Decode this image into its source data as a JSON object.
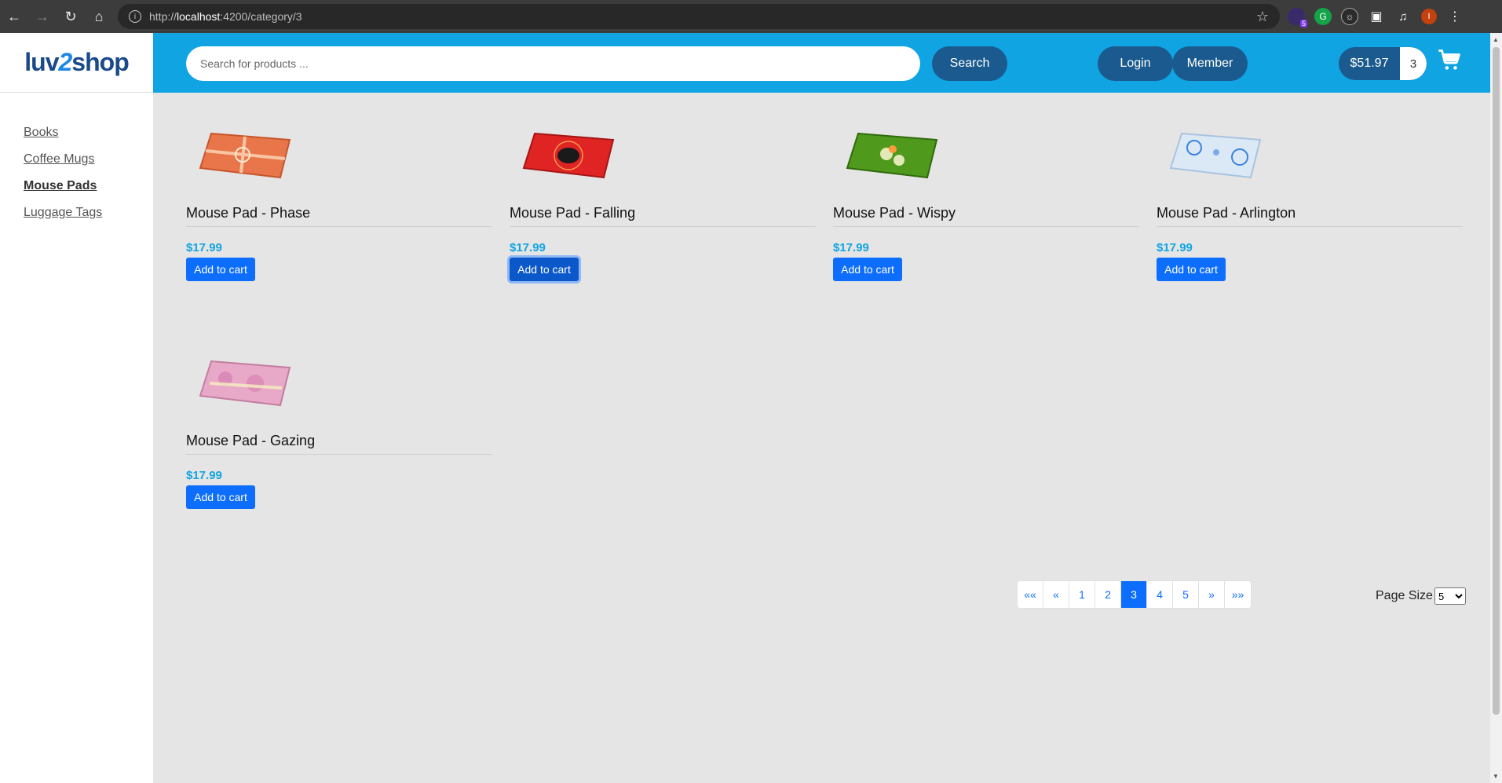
{
  "browser": {
    "url_prefix": "http://",
    "url_host": "localhost",
    "url_path": ":4200/category/3",
    "ext_badge": "5",
    "profile_initial": "I"
  },
  "logo": {
    "part1": "luv",
    "part2": "2",
    "part3": "shop"
  },
  "sidebar": {
    "items": [
      {
        "label": "Books"
      },
      {
        "label": "Coffee Mugs"
      },
      {
        "label": "Mouse Pads",
        "active": true
      },
      {
        "label": "Luggage Tags"
      }
    ]
  },
  "header": {
    "search_placeholder": "Search for products ...",
    "search_label": "Search",
    "login_label": "Login",
    "member_label": "Member",
    "cart_total": "$51.97",
    "cart_qty": "3"
  },
  "products": [
    {
      "name": "Mouse Pad - Phase",
      "price": "$17.99",
      "button": "Add to cart",
      "color": "#e8764a",
      "accent": "#ffd9b8"
    },
    {
      "name": "Mouse Pad - Falling",
      "price": "$17.99",
      "button": "Add to cart",
      "color": "#e02424",
      "accent": "#1a1a1a"
    },
    {
      "name": "Mouse Pad - Wispy",
      "price": "$17.99",
      "button": "Add to cart",
      "color": "#4f9a1c",
      "accent": "#f2f2c8"
    },
    {
      "name": "Mouse Pad - Arlington",
      "price": "$17.99",
      "button": "Add to cart",
      "color": "#dbe9f7",
      "accent": "#3b82e0"
    },
    {
      "name": "Mouse Pad - Gazing",
      "price": "$17.99",
      "button": "Add to cart",
      "color": "#e8a8c8",
      "accent": "#f7f0c0"
    }
  ],
  "pagination": {
    "first": "««",
    "prev": "«",
    "pages": [
      "1",
      "2",
      "3",
      "4",
      "5"
    ],
    "current": "3",
    "next": "»",
    "last": "»»"
  },
  "page_size": {
    "label": "Page Size",
    "value": "5"
  },
  "colors": {
    "header_bg": "#10a4e2",
    "button_dark": "#1a5a8e",
    "primary": "#0d6efd"
  }
}
